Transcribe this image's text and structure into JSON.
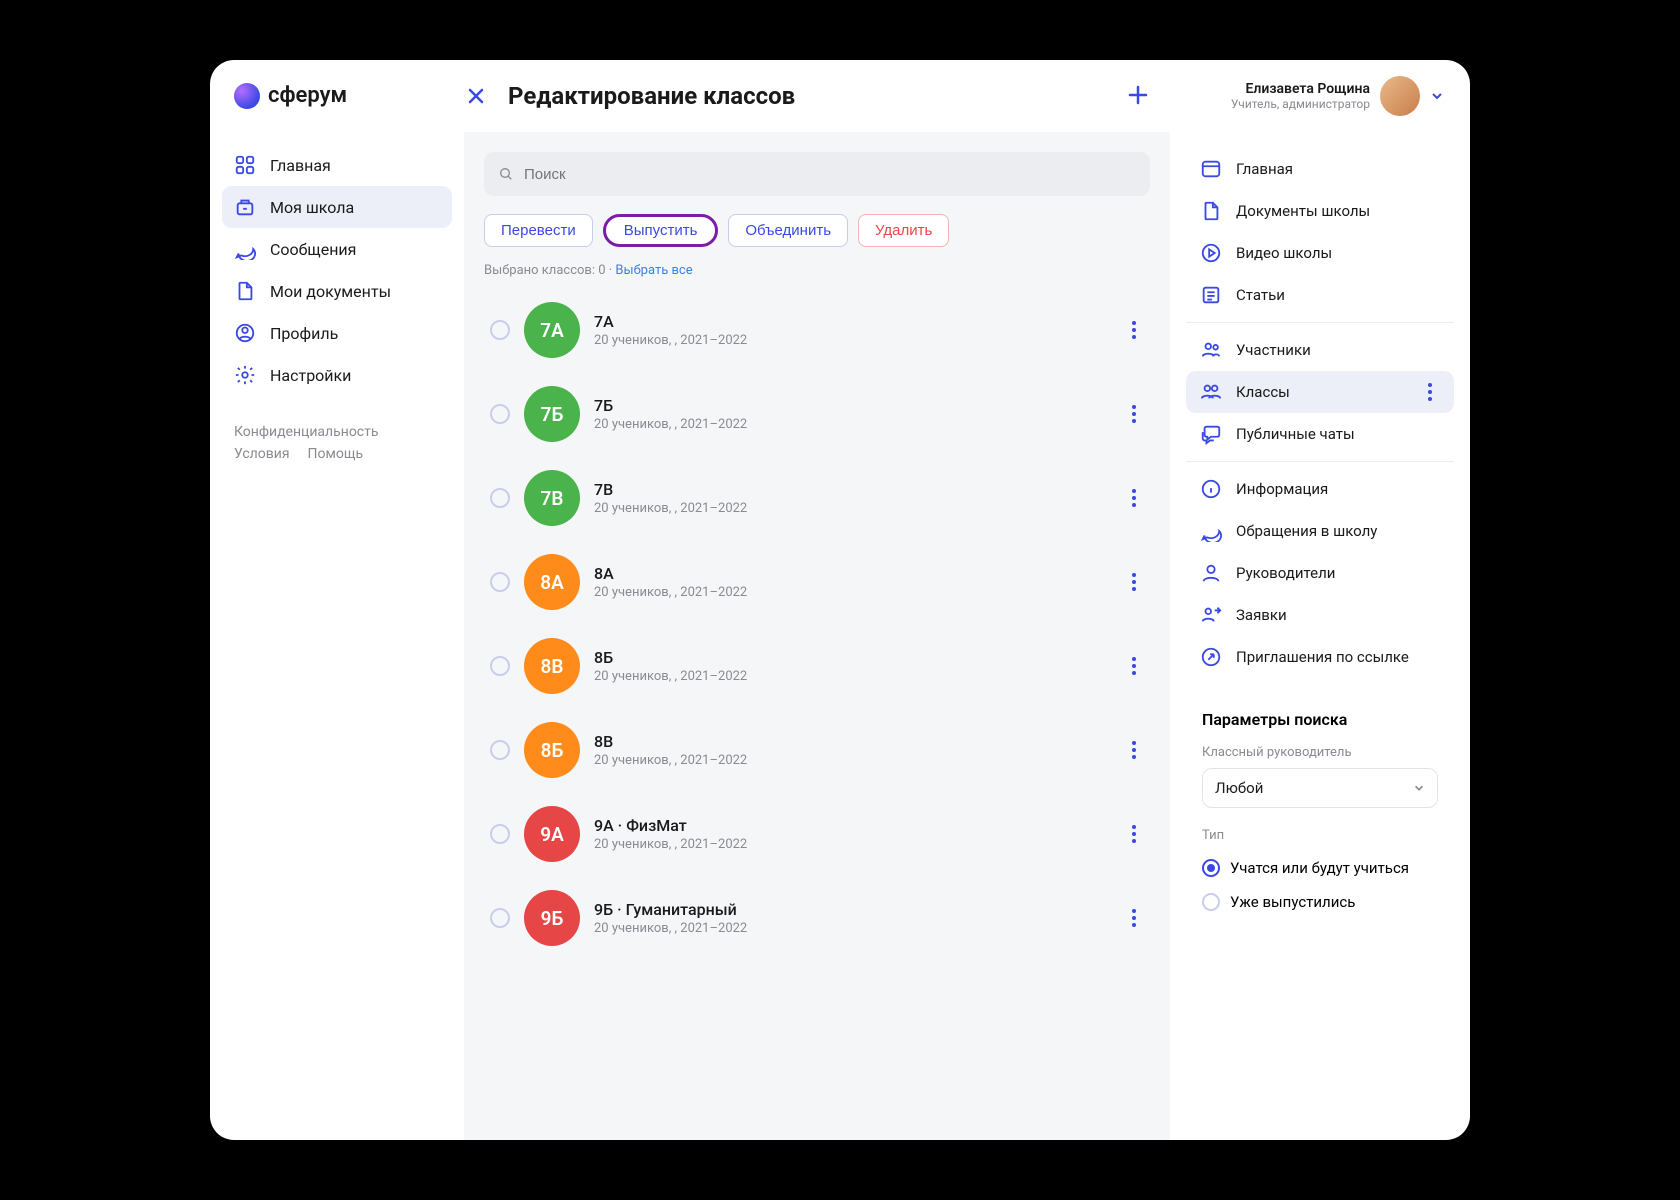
{
  "logo": {
    "text": "сферум"
  },
  "header": {
    "title": "Редактирование классов",
    "user": {
      "name": "Елизавета Рощина",
      "role": "Учитель, администратор"
    }
  },
  "sidebar": {
    "items": [
      {
        "label": "Главная"
      },
      {
        "label": "Моя школа"
      },
      {
        "label": "Сообщения"
      },
      {
        "label": "Мои документы"
      },
      {
        "label": "Профиль"
      },
      {
        "label": "Настройки"
      }
    ],
    "footer": [
      {
        "label": "Конфиденциальность"
      },
      {
        "label": "Условия"
      },
      {
        "label": "Помощь"
      }
    ]
  },
  "search": {
    "placeholder": "Поиск"
  },
  "actions": {
    "transfer": "Перевести",
    "release": "Выпустить",
    "merge": "Объединить",
    "delete": "Удалить"
  },
  "selection": {
    "prefix": "Выбрано классов: ",
    "count": "0",
    "selectall": "Выбрать все"
  },
  "classes": [
    {
      "badge": "7А",
      "color": "g",
      "title": "7А",
      "sub": "20 учеников, , 2021–2022"
    },
    {
      "badge": "7Б",
      "color": "g",
      "title": "7Б",
      "sub": "20 учеников, , 2021–2022"
    },
    {
      "badge": "7В",
      "color": "g",
      "title": "7В",
      "sub": "20 учеников, , 2021–2022"
    },
    {
      "badge": "8А",
      "color": "o",
      "title": "8А",
      "sub": "20 учеников, , 2021–2022"
    },
    {
      "badge": "8В",
      "color": "o",
      "title": "8Б",
      "sub": "20 учеников, , 2021–2022"
    },
    {
      "badge": "8Б",
      "color": "o",
      "title": "8В",
      "sub": "20 учеников, , 2021–2022"
    },
    {
      "badge": "9А",
      "color": "r",
      "title": "9А · ФизМат",
      "sub": "20 учеников, , 2021–2022"
    },
    {
      "badge": "9Б",
      "color": "r",
      "title": "9Б · Гуманитарный",
      "sub": "20 учеников, , 2021–2022"
    }
  ],
  "right": {
    "group1": [
      {
        "label": "Главная"
      },
      {
        "label": "Документы школы"
      },
      {
        "label": "Видео школы"
      },
      {
        "label": "Статьи"
      }
    ],
    "group2": [
      {
        "label": "Участники"
      },
      {
        "label": "Классы"
      },
      {
        "label": "Публичные чаты"
      }
    ],
    "group3": [
      {
        "label": "Информация"
      },
      {
        "label": "Обращения в школу"
      },
      {
        "label": "Руководители"
      },
      {
        "label": "Заявки"
      },
      {
        "label": "Приглашения по ссылке"
      }
    ]
  },
  "filters": {
    "title": "Параметры поиска",
    "class_teacher_label": "Классный руководитель",
    "class_teacher_value": "Любой",
    "type_label": "Тип",
    "type_options": [
      {
        "label": "Учатся или будут учиться",
        "selected": true
      },
      {
        "label": "Уже выпустились",
        "selected": false
      }
    ]
  }
}
